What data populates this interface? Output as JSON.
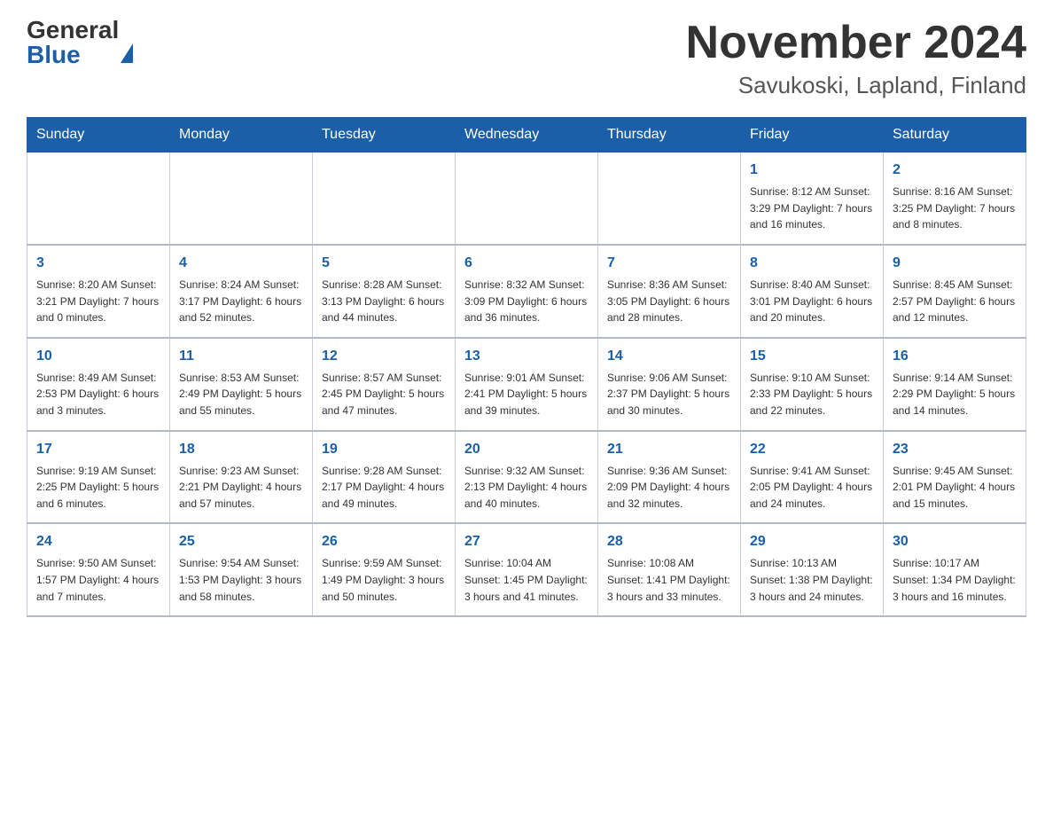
{
  "header": {
    "logo_general": "General",
    "logo_blue": "Blue",
    "month_title": "November 2024",
    "location": "Savukoski, Lapland, Finland"
  },
  "days_of_week": [
    "Sunday",
    "Monday",
    "Tuesday",
    "Wednesday",
    "Thursday",
    "Friday",
    "Saturday"
  ],
  "weeks": [
    {
      "days": [
        {
          "number": "",
          "info": ""
        },
        {
          "number": "",
          "info": ""
        },
        {
          "number": "",
          "info": ""
        },
        {
          "number": "",
          "info": ""
        },
        {
          "number": "",
          "info": ""
        },
        {
          "number": "1",
          "info": "Sunrise: 8:12 AM\nSunset: 3:29 PM\nDaylight: 7 hours and 16 minutes."
        },
        {
          "number": "2",
          "info": "Sunrise: 8:16 AM\nSunset: 3:25 PM\nDaylight: 7 hours and 8 minutes."
        }
      ]
    },
    {
      "days": [
        {
          "number": "3",
          "info": "Sunrise: 8:20 AM\nSunset: 3:21 PM\nDaylight: 7 hours and 0 minutes."
        },
        {
          "number": "4",
          "info": "Sunrise: 8:24 AM\nSunset: 3:17 PM\nDaylight: 6 hours and 52 minutes."
        },
        {
          "number": "5",
          "info": "Sunrise: 8:28 AM\nSunset: 3:13 PM\nDaylight: 6 hours and 44 minutes."
        },
        {
          "number": "6",
          "info": "Sunrise: 8:32 AM\nSunset: 3:09 PM\nDaylight: 6 hours and 36 minutes."
        },
        {
          "number": "7",
          "info": "Sunrise: 8:36 AM\nSunset: 3:05 PM\nDaylight: 6 hours and 28 minutes."
        },
        {
          "number": "8",
          "info": "Sunrise: 8:40 AM\nSunset: 3:01 PM\nDaylight: 6 hours and 20 minutes."
        },
        {
          "number": "9",
          "info": "Sunrise: 8:45 AM\nSunset: 2:57 PM\nDaylight: 6 hours and 12 minutes."
        }
      ]
    },
    {
      "days": [
        {
          "number": "10",
          "info": "Sunrise: 8:49 AM\nSunset: 2:53 PM\nDaylight: 6 hours and 3 minutes."
        },
        {
          "number": "11",
          "info": "Sunrise: 8:53 AM\nSunset: 2:49 PM\nDaylight: 5 hours and 55 minutes."
        },
        {
          "number": "12",
          "info": "Sunrise: 8:57 AM\nSunset: 2:45 PM\nDaylight: 5 hours and 47 minutes."
        },
        {
          "number": "13",
          "info": "Sunrise: 9:01 AM\nSunset: 2:41 PM\nDaylight: 5 hours and 39 minutes."
        },
        {
          "number": "14",
          "info": "Sunrise: 9:06 AM\nSunset: 2:37 PM\nDaylight: 5 hours and 30 minutes."
        },
        {
          "number": "15",
          "info": "Sunrise: 9:10 AM\nSunset: 2:33 PM\nDaylight: 5 hours and 22 minutes."
        },
        {
          "number": "16",
          "info": "Sunrise: 9:14 AM\nSunset: 2:29 PM\nDaylight: 5 hours and 14 minutes."
        }
      ]
    },
    {
      "days": [
        {
          "number": "17",
          "info": "Sunrise: 9:19 AM\nSunset: 2:25 PM\nDaylight: 5 hours and 6 minutes."
        },
        {
          "number": "18",
          "info": "Sunrise: 9:23 AM\nSunset: 2:21 PM\nDaylight: 4 hours and 57 minutes."
        },
        {
          "number": "19",
          "info": "Sunrise: 9:28 AM\nSunset: 2:17 PM\nDaylight: 4 hours and 49 minutes."
        },
        {
          "number": "20",
          "info": "Sunrise: 9:32 AM\nSunset: 2:13 PM\nDaylight: 4 hours and 40 minutes."
        },
        {
          "number": "21",
          "info": "Sunrise: 9:36 AM\nSunset: 2:09 PM\nDaylight: 4 hours and 32 minutes."
        },
        {
          "number": "22",
          "info": "Sunrise: 9:41 AM\nSunset: 2:05 PM\nDaylight: 4 hours and 24 minutes."
        },
        {
          "number": "23",
          "info": "Sunrise: 9:45 AM\nSunset: 2:01 PM\nDaylight: 4 hours and 15 minutes."
        }
      ]
    },
    {
      "days": [
        {
          "number": "24",
          "info": "Sunrise: 9:50 AM\nSunset: 1:57 PM\nDaylight: 4 hours and 7 minutes."
        },
        {
          "number": "25",
          "info": "Sunrise: 9:54 AM\nSunset: 1:53 PM\nDaylight: 3 hours and 58 minutes."
        },
        {
          "number": "26",
          "info": "Sunrise: 9:59 AM\nSunset: 1:49 PM\nDaylight: 3 hours and 50 minutes."
        },
        {
          "number": "27",
          "info": "Sunrise: 10:04 AM\nSunset: 1:45 PM\nDaylight: 3 hours and 41 minutes."
        },
        {
          "number": "28",
          "info": "Sunrise: 10:08 AM\nSunset: 1:41 PM\nDaylight: 3 hours and 33 minutes."
        },
        {
          "number": "29",
          "info": "Sunrise: 10:13 AM\nSunset: 1:38 PM\nDaylight: 3 hours and 24 minutes."
        },
        {
          "number": "30",
          "info": "Sunrise: 10:17 AM\nSunset: 1:34 PM\nDaylight: 3 hours and 16 minutes."
        }
      ]
    }
  ]
}
